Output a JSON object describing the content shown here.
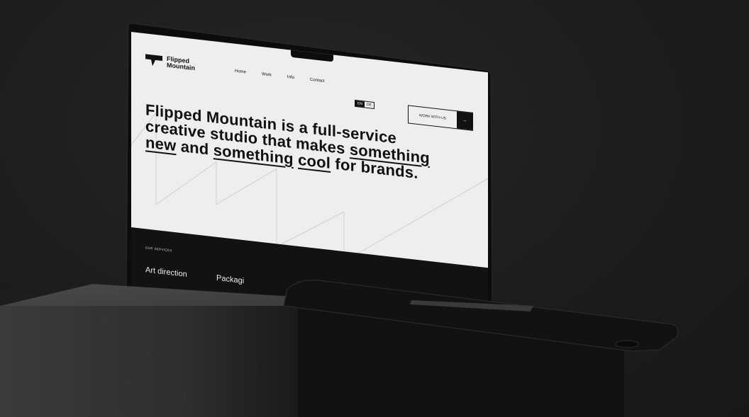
{
  "brand": {
    "line1": "Flipped",
    "line2": "Mountain"
  },
  "nav": {
    "items": [
      "Home",
      "Work",
      "Info",
      "Contact"
    ]
  },
  "lang": {
    "en": "EN",
    "de": "DE"
  },
  "cta": {
    "label": "WORK WITH US",
    "arrow": "→"
  },
  "hero": {
    "part1": "Flipped Mountain is a full-service creative studio that makes ",
    "u1": "something new",
    "part2": " and ",
    "u2": "something",
    "part3": " ",
    "u3": "cool",
    "part4": " for brands."
  },
  "services": {
    "title": "OUR SERVICES",
    "item1": "Art direction",
    "item2": "Packagi"
  },
  "colors": {
    "background": "#1d1d1d",
    "screen": "#eeeeee",
    "ink": "#111111",
    "services_bg": "#121212"
  }
}
